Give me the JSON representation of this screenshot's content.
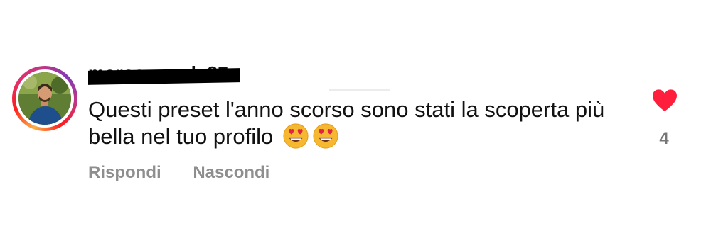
{
  "comment": {
    "username": "marco_verde87",
    "text": "Questi preset l'anno scorso sono stati la scoperta più bella nel tuo profilo",
    "emoji": [
      "heart-eyes-emoji",
      "heart-eyes-emoji"
    ],
    "like_count": "4",
    "actions": {
      "reply_label": "Rispondi",
      "hide_label": "Nascondi"
    }
  },
  "colors": {
    "like_heart": "#ff1f3d",
    "action_text": "#8e8e8e",
    "text": "#111111"
  }
}
